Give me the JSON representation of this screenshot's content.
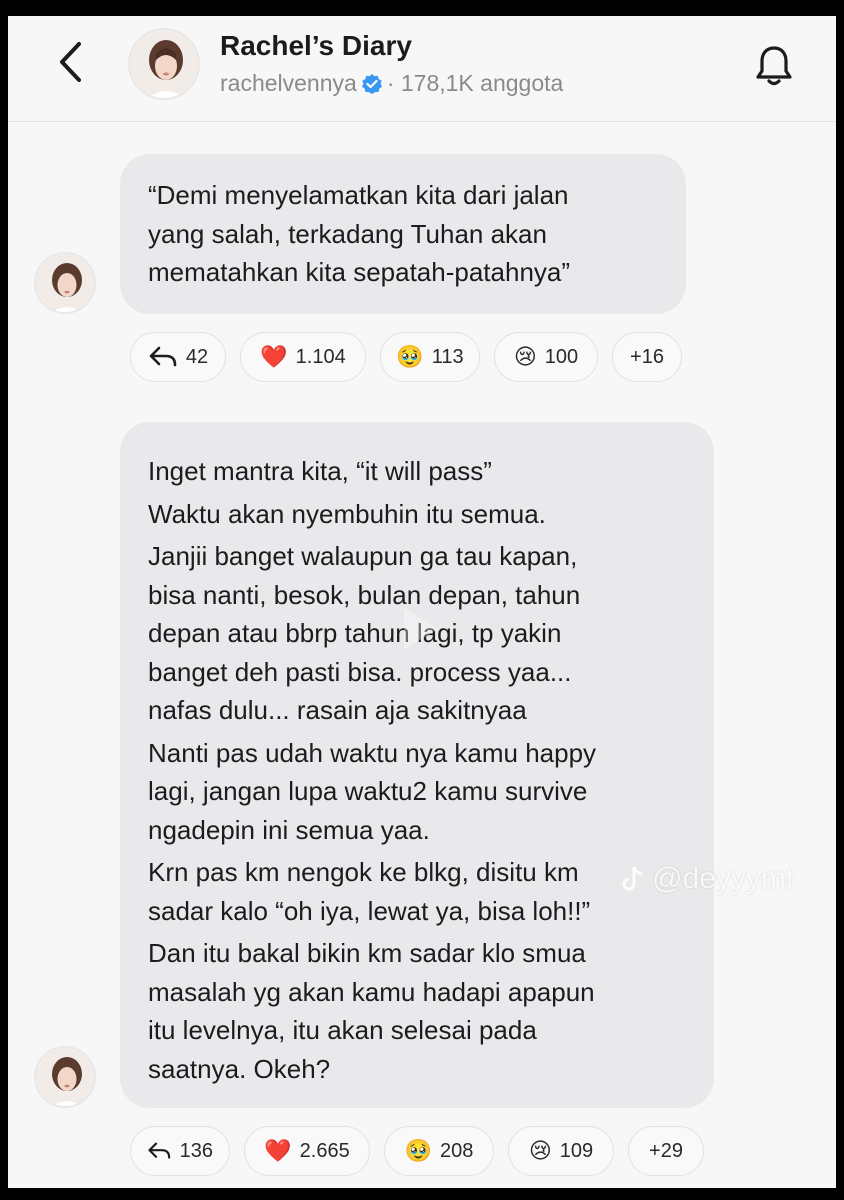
{
  "header": {
    "back_icon": "chevron-left-icon",
    "title": "Rachel’s Diary",
    "username": "rachelvennya",
    "members": "· 178,1K anggota",
    "bell_icon": "bell-icon"
  },
  "messages": [
    {
      "lines": [
        "“Demi menyelamatkan kita dari jalan",
        "yang salah, terkadang Tuhan akan",
        "mematahkan kita sepatah-patahnya”"
      ],
      "reactions": {
        "reply": "42",
        "heart": "1.104",
        "pleading": "113",
        "crying": "100",
        "more": "+16"
      }
    },
    {
      "paragraphs": [
        [
          "Inget mantra kita, “it will pass”"
        ],
        [
          "Waktu akan nyembuhin itu semua."
        ],
        [
          "Janjii banget walaupun ga tau kapan,",
          "bisa nanti, besok, bulan depan, tahun",
          "depan atau bbrp tahun lagi, tp yakin",
          "banget deh pasti bisa. process yaa...",
          "nafas dulu... rasain aja sakitnyaa"
        ],
        [
          "Nanti pas udah waktu nya kamu happy",
          "lagi, jangan lupa waktu2 kamu survive",
          "ngadepin ini semua yaa."
        ],
        [
          "Krn pas km nengok ke blkg, disitu km",
          "sadar kalo “oh iya, lewat ya, bisa loh!!”"
        ],
        [
          "Dan itu bakal bikin km sadar klo smua",
          "masalah yg akan kamu hadapi apapun",
          "itu levelnya, itu akan selesai pada",
          "saatnya. Okeh?"
        ]
      ],
      "reactions": {
        "reply": "136",
        "heart": "2.665",
        "pleading": "208",
        "crying": "109",
        "more": "+29"
      }
    }
  ],
  "emoji": {
    "heart": "❤️",
    "pleading": "🥹",
    "crying": "😢"
  },
  "watermark": "@deyyymt",
  "colors": {
    "background": "#f7f7f7",
    "bubble": "#e9e9eb",
    "verified": "#3897f0",
    "text": "#1c1c1e",
    "muted": "#8a8a8e"
  }
}
